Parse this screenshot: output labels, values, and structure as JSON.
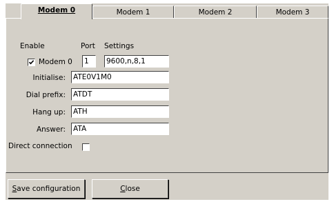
{
  "tabs": [
    {
      "label": "Modem 0",
      "active": true
    },
    {
      "label": "Modem 1",
      "active": false
    },
    {
      "label": "Modem 2",
      "active": false
    },
    {
      "label": "Modem 3",
      "active": false
    }
  ],
  "headers": {
    "enable": "Enable",
    "port": "Port",
    "settings": "Settings"
  },
  "modem": {
    "enable_label": "Modem 0",
    "enabled": true,
    "port": "1",
    "settings": "9600,n,8,1"
  },
  "fields": {
    "initialise": {
      "label": "Initialise:",
      "value": "ATE0V1M0"
    },
    "dial_prefix": {
      "label": "Dial prefix:",
      "value": "ATDT"
    },
    "hang_up": {
      "label": "Hang up:",
      "value": "ATH"
    },
    "answer": {
      "label": "Answer:",
      "value": "ATA"
    }
  },
  "direct_connection": {
    "label": "Direct connection",
    "checked": false
  },
  "buttons": {
    "save": {
      "mnemonic": "S",
      "rest": "ave configuration"
    },
    "close": {
      "mnemonic": "C",
      "rest": "lose"
    }
  }
}
